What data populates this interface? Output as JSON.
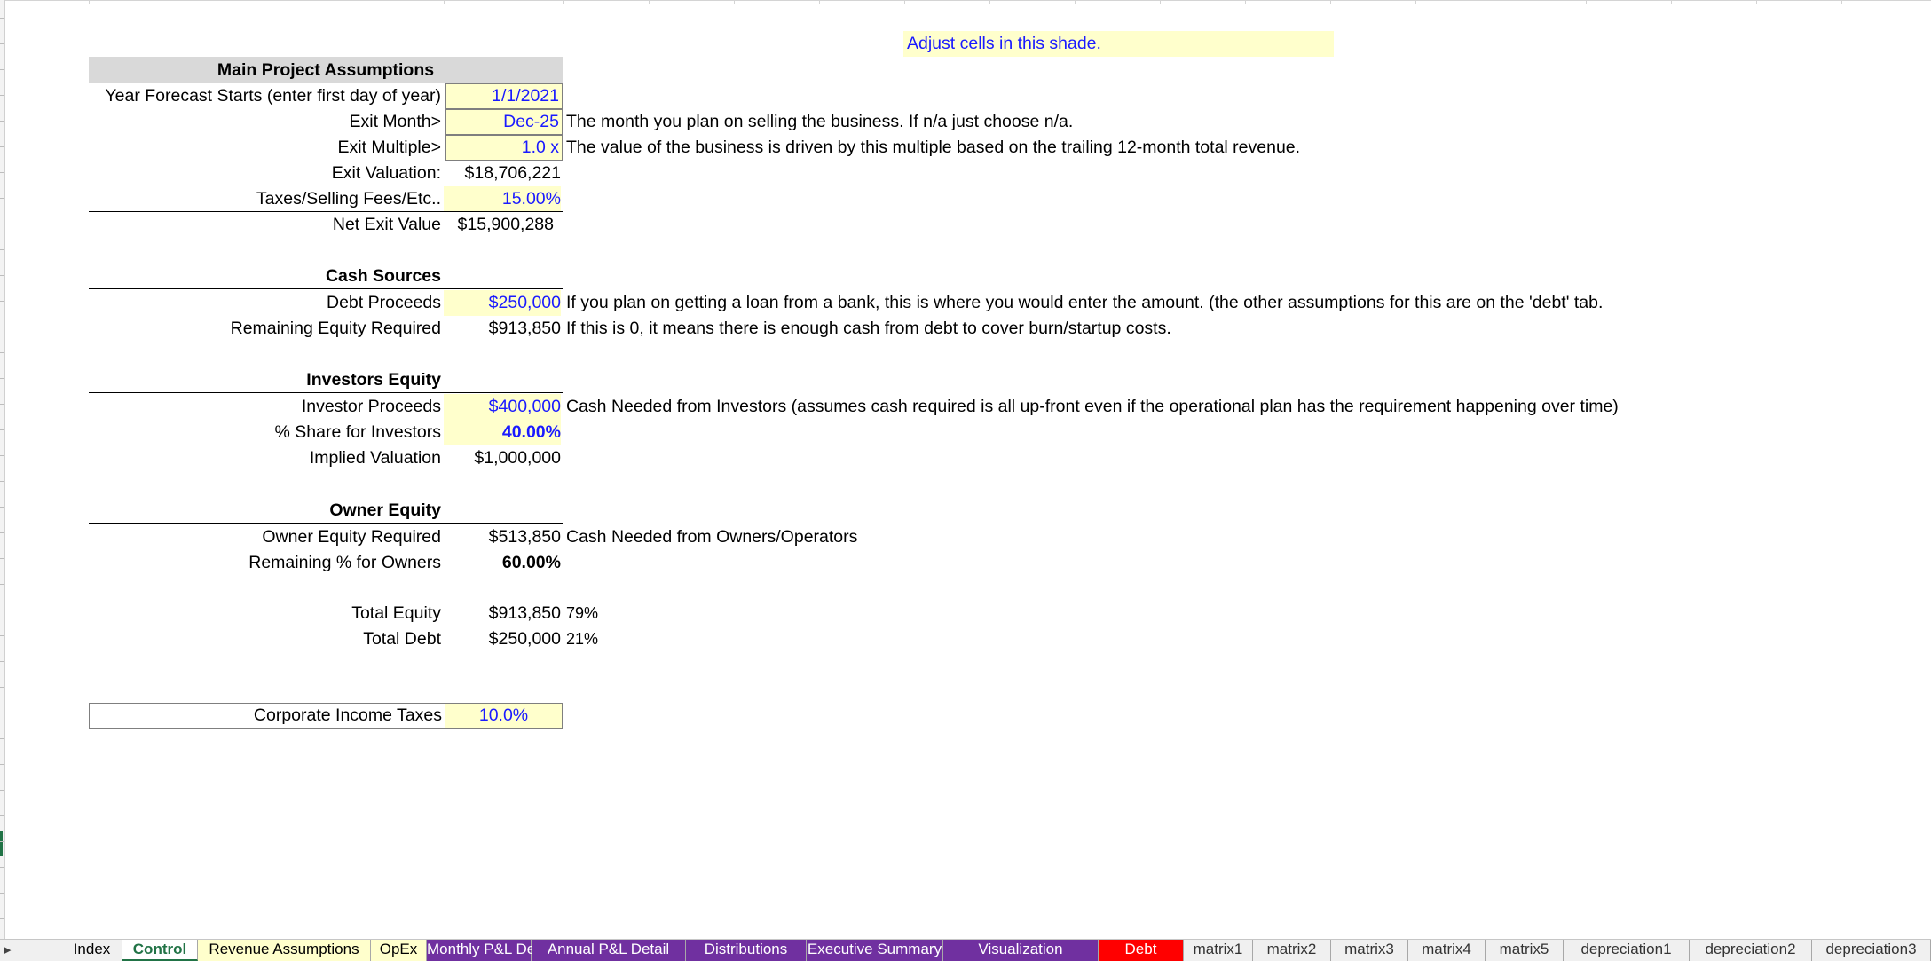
{
  "note_banner": "Adjust cells in this shade.",
  "main": {
    "header": "Main Project Assumptions",
    "year_start_label": "Year Forecast Starts (enter first day of year)",
    "year_start_value": "1/1/2021",
    "exit_month_label": "Exit Month>",
    "exit_month_value": "Dec-25",
    "exit_month_note": "The month you plan on selling the business. If n/a just choose n/a.",
    "exit_multiple_label": "Exit Multiple>",
    "exit_multiple_value": "1.0 x",
    "exit_multiple_note": "The value of the business is driven by this multiple based on the trailing 12-month total revenue.",
    "exit_valuation_label": "Exit Valuation:",
    "exit_valuation_value": "$18,706,221",
    "taxes_label": "Taxes/Selling Fees/Etc..",
    "taxes_value": "15.00%",
    "net_exit_label": "Net Exit Value",
    "net_exit_value": "$15,900,288"
  },
  "cash_sources": {
    "header": "Cash Sources",
    "debt_label": "Debt Proceeds",
    "debt_value": "$250,000",
    "debt_note": "If you plan on getting a loan from a bank, this is where you would enter the amount. (the other assumptions for this are on the 'debt' tab.",
    "remaining_label": "Remaining Equity Required",
    "remaining_value": "$913,850",
    "remaining_note": "If this is 0, it means there is enough cash from debt to cover burn/startup costs."
  },
  "investors": {
    "header": "Investors Equity",
    "proceeds_label": "Investor Proceeds",
    "proceeds_value": "$400,000",
    "proceeds_note": "Cash Needed from Investors (assumes cash required is all up-front even if the operational plan has the requirement happening over time)",
    "share_label": "% Share for Investors",
    "share_value": "40.00%",
    "valuation_label": "Implied Valuation",
    "valuation_value": "$1,000,000"
  },
  "owner": {
    "header": "Owner Equity",
    "required_label": "Owner Equity Required",
    "required_value": "$513,850",
    "required_note": "Cash Needed from Owners/Operators",
    "remaining_label": "Remaining % for Owners",
    "remaining_value": "60.00%"
  },
  "totals": {
    "equity_label": "Total Equity",
    "equity_value": "$913,850",
    "equity_pct": "79%",
    "debt_label": "Total Debt",
    "debt_value": "$250,000",
    "debt_pct": "21%"
  },
  "corp_tax": {
    "label": "Corporate Income Taxes",
    "value": "10.0%"
  },
  "tabs": [
    {
      "label": "Index",
      "bg": "#f0f0f0",
      "fg": "#000000"
    },
    {
      "label": "Control",
      "bg": "#ffffff",
      "fg": "#217346",
      "active": true
    },
    {
      "label": "Revenue Assumptions",
      "bg": "#ffffcc",
      "fg": "#000000"
    },
    {
      "label": "OpEx",
      "bg": "#ffffcc",
      "fg": "#000000"
    },
    {
      "label": "Monthly P&L Detail",
      "bg": "#7030a0",
      "fg": "#ffffff"
    },
    {
      "label": "Annual P&L Detail",
      "bg": "#7030a0",
      "fg": "#ffffff"
    },
    {
      "label": "Distributions",
      "bg": "#7030a0",
      "fg": "#ffffff"
    },
    {
      "label": "Executive Summary",
      "bg": "#7030a0",
      "fg": "#ffffff"
    },
    {
      "label": "Visualization",
      "bg": "#7030a0",
      "fg": "#ffffff"
    },
    {
      "label": "Debt",
      "bg": "#ff0000",
      "fg": "#ffffff"
    },
    {
      "label": "matrix1",
      "bg": "#f0f0f0",
      "fg": "#333333"
    },
    {
      "label": "matrix2",
      "bg": "#f0f0f0",
      "fg": "#333333"
    },
    {
      "label": "matrix3",
      "bg": "#f0f0f0",
      "fg": "#333333"
    },
    {
      "label": "matrix4",
      "bg": "#f0f0f0",
      "fg": "#333333"
    },
    {
      "label": "matrix5",
      "bg": "#f0f0f0",
      "fg": "#333333"
    },
    {
      "label": "depreciation1",
      "bg": "#f0f0f0",
      "fg": "#333333"
    },
    {
      "label": "depreciation2",
      "bg": "#f0f0f0",
      "fg": "#333333"
    },
    {
      "label": "depreciation3",
      "bg": "#f0f0f0",
      "fg": "#333333"
    }
  ]
}
